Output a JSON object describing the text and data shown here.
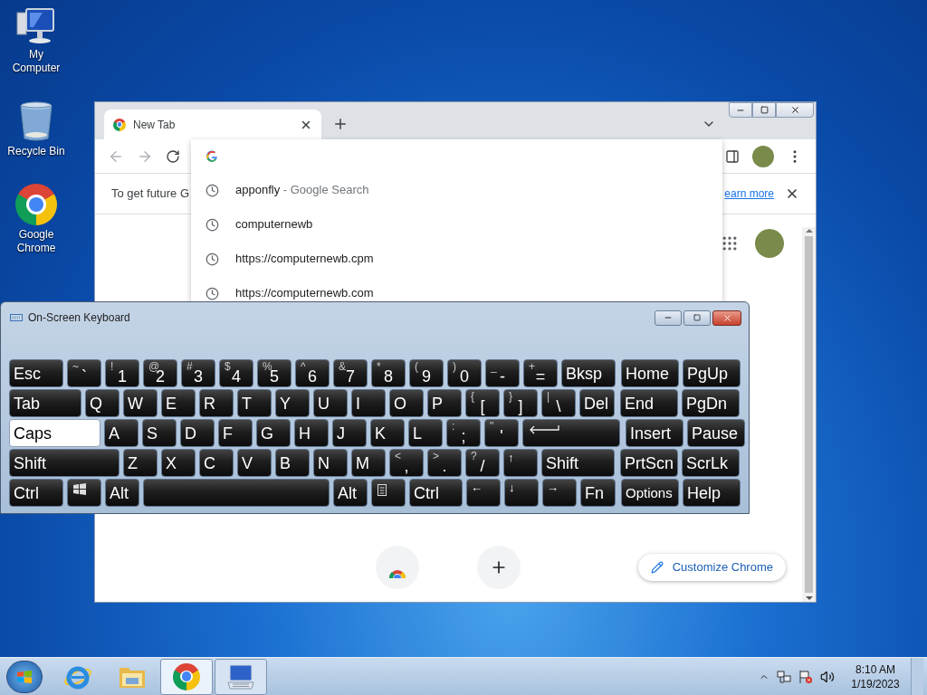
{
  "desktop_icons": [
    {
      "label": "My Computer",
      "kind": "computer"
    },
    {
      "label": "Recycle Bin",
      "kind": "recycle"
    },
    {
      "label": "Google Chrome",
      "kind": "chrome"
    }
  ],
  "browser": {
    "tabs": [
      {
        "title": "New Tab",
        "selected": true
      }
    ],
    "infobar": {
      "text": "To get future G",
      "link": "earn more"
    },
    "suggestions": [
      {
        "text": "apponfly",
        "description": "- Google Search"
      },
      {
        "text": "computernewb"
      },
      {
        "text": "https://computernewb.cpm"
      },
      {
        "text": "https://computernewb.com"
      }
    ],
    "customize_button": "Customize Chrome"
  },
  "keyboard": {
    "title": "On-Screen Keyboard",
    "rows": [
      {
        "keys": [
          {
            "kind": "name",
            "label": "Esc",
            "on": false
          },
          {
            "kind": "dual",
            "shift": "~",
            "label": "`",
            "on": false
          },
          {
            "kind": "dual",
            "shift": "!",
            "label": "1",
            "on": false
          },
          {
            "kind": "dual",
            "shift": "@",
            "label": "2",
            "on": false
          },
          {
            "kind": "dual",
            "shift": "#",
            "label": "3",
            "on": false
          },
          {
            "kind": "dual",
            "shift": "$",
            "label": "4",
            "on": false
          },
          {
            "kind": "dual",
            "shift": "%",
            "label": "5",
            "on": false
          },
          {
            "kind": "dual",
            "shift": "^",
            "label": "6",
            "on": false
          },
          {
            "kind": "dual",
            "shift": "&",
            "label": "7",
            "on": false
          },
          {
            "kind": "dual",
            "shift": "*",
            "label": "8",
            "on": false
          },
          {
            "kind": "dual",
            "shift": "(",
            "label": "9",
            "on": false
          },
          {
            "kind": "dual",
            "shift": ")",
            "label": "0",
            "on": false
          },
          {
            "kind": "dual",
            "shift": "_",
            "label": "-",
            "on": false
          },
          {
            "kind": "dual",
            "shift": "+",
            "label": "=",
            "on": false
          },
          {
            "kind": "name",
            "label": "Bksp",
            "on": false
          }
        ],
        "nav_keys": [
          {
            "kind": "name",
            "label": "Home",
            "on": false
          },
          {
            "kind": "name",
            "label": "PgUp",
            "on": false
          }
        ]
      },
      {
        "keys": [
          {
            "kind": "name",
            "label": "Tab",
            "on": false
          },
          {
            "kind": "name",
            "label": "Q",
            "on": false
          },
          {
            "kind": "name",
            "label": "W",
            "on": false
          },
          {
            "kind": "name",
            "label": "E",
            "on": false
          },
          {
            "kind": "name",
            "label": "R",
            "on": false
          },
          {
            "kind": "name",
            "label": "T",
            "on": false
          },
          {
            "kind": "name",
            "label": "Y",
            "on": false
          },
          {
            "kind": "name",
            "label": "U",
            "on": false
          },
          {
            "kind": "name",
            "label": "I",
            "on": false
          },
          {
            "kind": "name",
            "label": "O",
            "on": false
          },
          {
            "kind": "name",
            "label": "P",
            "on": false
          },
          {
            "kind": "dual",
            "shift": "{",
            "label": "[",
            "on": false
          },
          {
            "kind": "dual",
            "shift": "}",
            "label": "]",
            "on": false
          },
          {
            "kind": "dual",
            "shift": "|",
            "label": "\\",
            "on": false
          },
          {
            "kind": "name",
            "label": "Del",
            "on": false
          }
        ],
        "nav_keys": [
          {
            "kind": "name",
            "label": "End",
            "on": false
          },
          {
            "kind": "name",
            "label": "PgDn",
            "on": false
          }
        ]
      },
      {
        "keys": [
          {
            "kind": "name",
            "label": "Caps",
            "on": true
          },
          {
            "kind": "name",
            "label": "A",
            "on": false
          },
          {
            "kind": "name",
            "label": "S",
            "on": false
          },
          {
            "kind": "name",
            "label": "D",
            "on": false
          },
          {
            "kind": "name",
            "label": "F",
            "on": false
          },
          {
            "kind": "name",
            "label": "G",
            "on": false
          },
          {
            "kind": "name",
            "label": "H",
            "on": false
          },
          {
            "kind": "name",
            "label": "J",
            "on": false
          },
          {
            "kind": "name",
            "label": "K",
            "on": false
          },
          {
            "kind": "name",
            "label": "L",
            "on": false
          },
          {
            "kind": "dual",
            "shift": ":",
            "label": ";",
            "on": false
          },
          {
            "kind": "dual",
            "shift": "\"",
            "label": "'",
            "on": false
          },
          {
            "kind": "enter",
            "on": false
          }
        ],
        "nav_keys": [
          {
            "kind": "name",
            "label": "Insert",
            "on": false
          },
          {
            "kind": "name",
            "label": "Pause",
            "on": false
          }
        ]
      },
      {
        "keys": [
          {
            "kind": "name",
            "label": "Shift",
            "on": false
          },
          {
            "kind": "name",
            "label": "Z",
            "on": false
          },
          {
            "kind": "name",
            "label": "X",
            "on": false
          },
          {
            "kind": "name",
            "label": "C",
            "on": false
          },
          {
            "kind": "name",
            "label": "V",
            "on": false
          },
          {
            "kind": "name",
            "label": "B",
            "on": false
          },
          {
            "kind": "name",
            "label": "N",
            "on": false
          },
          {
            "kind": "name",
            "label": "M",
            "on": false
          },
          {
            "kind": "dual",
            "shift": "<",
            "label": ",",
            "on": false
          },
          {
            "kind": "dual",
            "shift": ">",
            "label": ".",
            "on": false
          },
          {
            "kind": "dual",
            "shift": "?",
            "label": "/",
            "on": false
          },
          {
            "kind": "arrow",
            "label": "↑",
            "on": false
          },
          {
            "kind": "name",
            "label": "Shift",
            "on": false
          }
        ],
        "nav_keys": [
          {
            "kind": "name",
            "label": "PrtScn",
            "on": false
          },
          {
            "kind": "name",
            "label": "ScrLk",
            "on": false
          }
        ]
      },
      {
        "keys": [
          {
            "kind": "name",
            "label": "Ctrl",
            "on": false
          },
          {
            "kind": "windows",
            "on": false
          },
          {
            "kind": "name",
            "label": "Alt",
            "on": false
          },
          {
            "kind": "space",
            "on": false
          },
          {
            "kind": "name",
            "label": "Alt",
            "on": false
          },
          {
            "kind": "menu",
            "on": false
          },
          {
            "kind": "name",
            "label": "Ctrl",
            "on": false
          },
          {
            "kind": "arrow",
            "label": "←",
            "on": false
          },
          {
            "kind": "arrow",
            "label": "↓",
            "on": false
          },
          {
            "kind": "arrow",
            "label": "→",
            "on": false
          },
          {
            "kind": "name",
            "label": "Fn",
            "on": false
          }
        ],
        "nav_keys": [
          {
            "kind": "small",
            "label": "Options",
            "on": false
          },
          {
            "kind": "name",
            "label": "Help",
            "on": false
          }
        ]
      }
    ]
  },
  "taskbar": {
    "apps": [
      {
        "kind": "ie",
        "running": false,
        "selected": false
      },
      {
        "kind": "explorer",
        "running": false,
        "selected": false
      },
      {
        "kind": "chrome",
        "running": true,
        "selected": true
      },
      {
        "kind": "keyboard",
        "running": true,
        "selected": false
      }
    ],
    "clock": {
      "time": "8:10 AM",
      "date": "1/19/2023"
    }
  }
}
